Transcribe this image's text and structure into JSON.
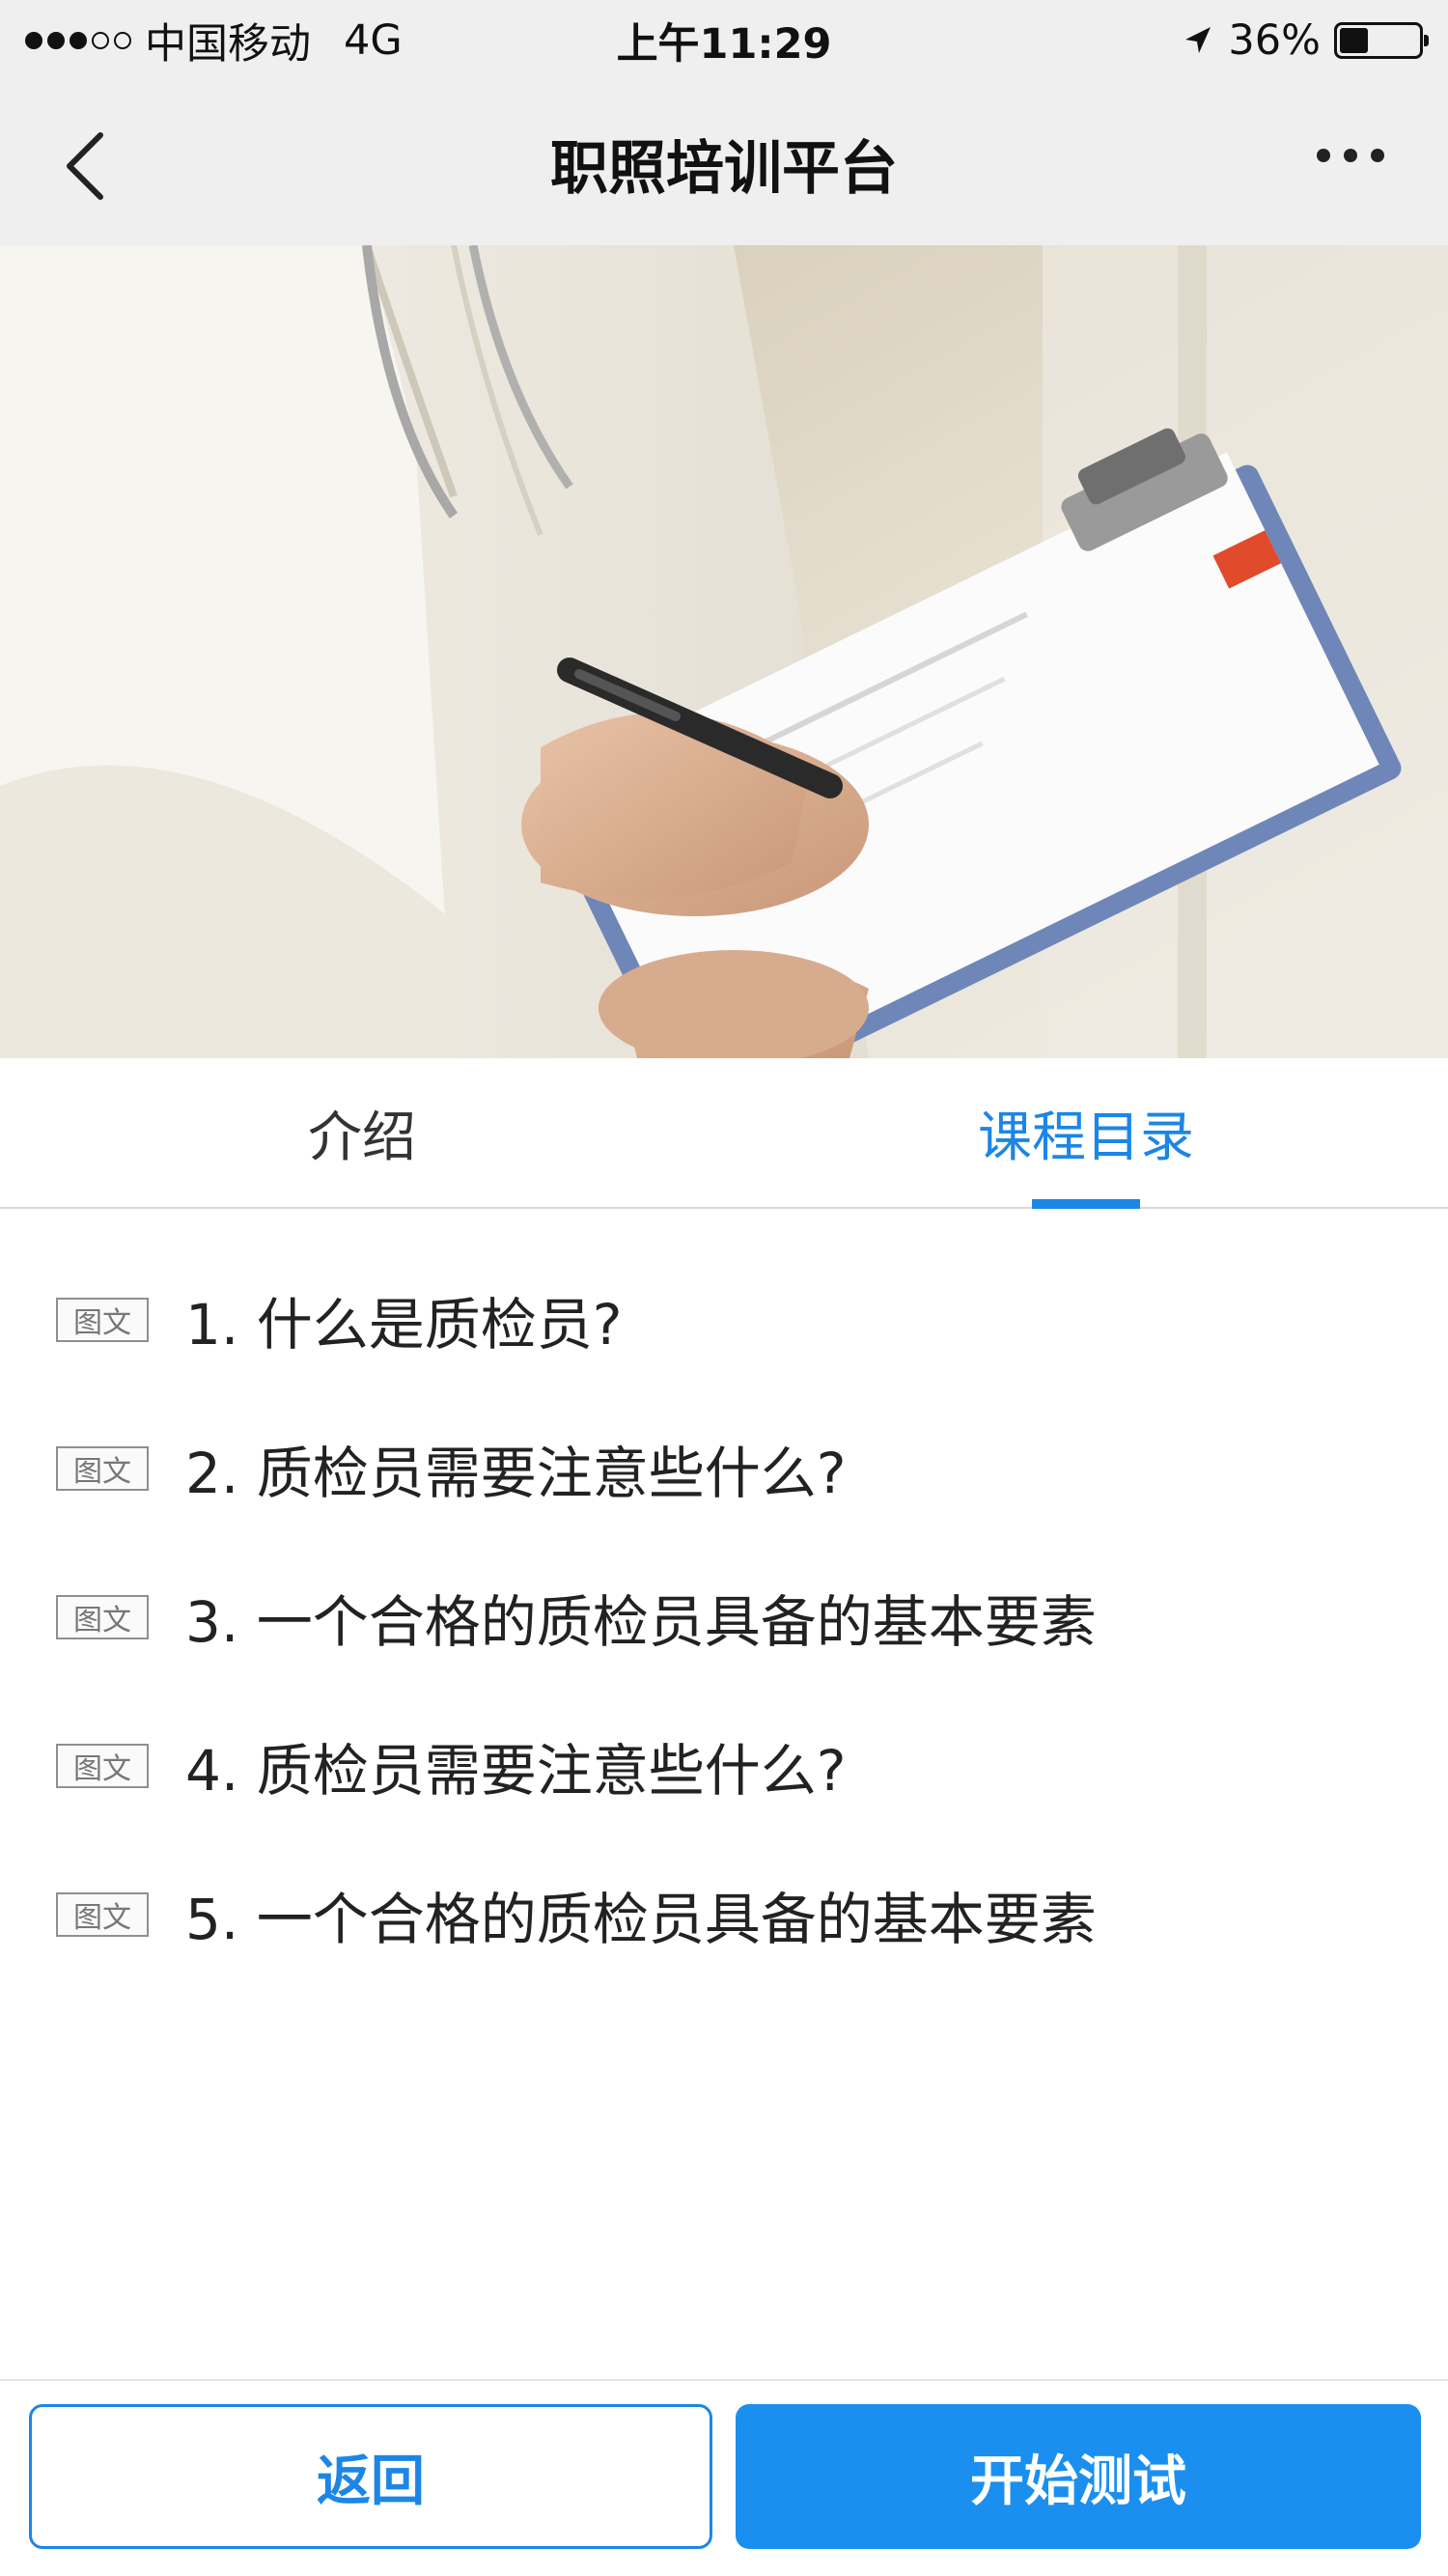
{
  "status_bar": {
    "carrier": "中国移动",
    "network": "4G",
    "time": "上午11:29",
    "battery": "36%",
    "battery_level": 0.36
  },
  "nav": {
    "title": "职照培训平台",
    "back_icon": "chevron-left-icon",
    "more_icon": "more-dots-icon"
  },
  "hero": {
    "image": "doctor-with-clipboard-photo"
  },
  "tabs": [
    {
      "label": "介绍",
      "active": false
    },
    {
      "label": "课程目录",
      "active": true
    }
  ],
  "courses": [
    {
      "badge": "图文",
      "title": "1. 什么是质检员?"
    },
    {
      "badge": "图文",
      "title": "2. 质检员需要注意些什么?"
    },
    {
      "badge": "图文",
      "title": "3. 一个合格的质检员具备的基本要素"
    },
    {
      "badge": "图文",
      "title": "4. 质检员需要注意些什么?"
    },
    {
      "badge": "图文",
      "title": "5. 一个合格的质检员具备的基本要素"
    }
  ],
  "footer": {
    "back_label": "返回",
    "start_label": "开始测试"
  },
  "colors": {
    "accent": "#1c86e6",
    "primary_button": "#1a8ff0",
    "bar_background": "#efefef"
  }
}
